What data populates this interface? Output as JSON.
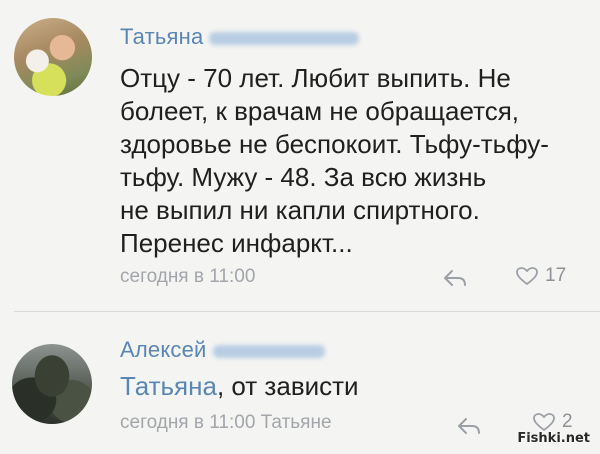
{
  "comments": [
    {
      "author": "Татьяна",
      "text_lines": [
        "Отцу - 70 лет. Любит выпить. Не",
        "болеет, к врачам не обращается,",
        "здоровье не беспокоит. Тьфу-тьфу-",
        "тьфу. Мужу - 48. За всю жизнь",
        "не выпил ни капли спиртного.",
        "Перенес инфаркт..."
      ],
      "timestamp": "сегодня в 11:00",
      "likes": "17"
    },
    {
      "author": "Алексей",
      "mention": "Татьяна",
      "text": ", от зависти",
      "timestamp": "сегодня в 11:00 Татьяне",
      "likes": "2"
    }
  ],
  "watermark": "Fishki.net",
  "icons": {
    "reply": "reply-arrow-icon",
    "like": "heart-outline-icon"
  },
  "colors": {
    "link": "#5a86b4",
    "meta": "#a2a6ab",
    "background": "#f4f4f2"
  }
}
